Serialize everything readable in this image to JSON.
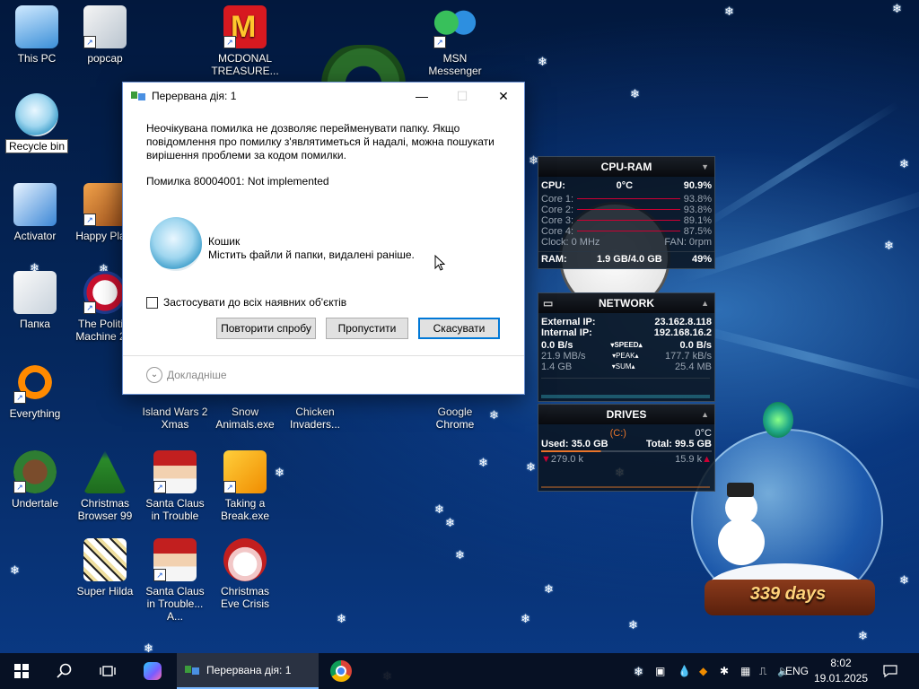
{
  "desktop": {
    "icons": [
      {
        "label": "This PC"
      },
      {
        "label": "popcap"
      },
      {
        "label": "MCDONAL TREASURE..."
      },
      {
        "label": "MSN Messenger"
      },
      {
        "label": "Recycle bin"
      },
      {
        "label": "Activator"
      },
      {
        "label": "Happy Pla..."
      },
      {
        "label": "Папка"
      },
      {
        "label": "The Politi... Machine 2..."
      },
      {
        "label": "Everything"
      },
      {
        "label": "Island Wars 2 Xmas"
      },
      {
        "label": "Snow Animals.exe"
      },
      {
        "label": "Chicken Invaders..."
      },
      {
        "label": "Google Chrome"
      },
      {
        "label": "Undertale"
      },
      {
        "label": "Christmas Browser 99"
      },
      {
        "label": "Santa Claus in Trouble"
      },
      {
        "label": "Taking a Break.exe"
      },
      {
        "label": "Super Hilda"
      },
      {
        "label": "Santa Claus in Trouble... A..."
      },
      {
        "label": "Christmas Eve Crisis"
      }
    ],
    "snowglobe_days": "339 days"
  },
  "dialog": {
    "title": "Перервана дія: 1",
    "message": "Неочікувана помилка не дозволяє перейменувати папку. Якщо повідомлення про помилку з'являтиметься й надалі, можна пошукати вирішення проблеми за кодом помилки.",
    "error_code": "Помилка 80004001: Not implemented",
    "item_name": "Кошик",
    "item_desc": "Містить файли й папки, видалені раніше.",
    "apply_all": "Застосувати до всіх наявних об'єктів",
    "retry": "Повторити спробу",
    "skip": "Пропустити",
    "cancel": "Скасувати",
    "more": "Докладніше"
  },
  "cpu_ram": {
    "title": "CPU-RAM",
    "cpu_label": "CPU:",
    "cpu_temp": "0°C",
    "cpu_pct": "90.9%",
    "cores": [
      {
        "label": "Core 1:",
        "value": "93.8%"
      },
      {
        "label": "Core 2:",
        "value": "93.8%"
      },
      {
        "label": "Core 3:",
        "value": "89.1%"
      },
      {
        "label": "Core 4:",
        "value": "87.5%"
      }
    ],
    "clock": "Clock: 0 MHz",
    "fan": "FAN: 0rpm",
    "ram_label": "RAM:",
    "ram_used": "1.9 GB/4.0 GB",
    "ram_pct": "49%"
  },
  "network": {
    "title": "NETWORK",
    "ext_label": "External IP:",
    "ext_ip": "23.162.8.118",
    "int_label": "Internal IP:",
    "int_ip": "192.168.16.2",
    "down": "0.0 B/s",
    "speed": "SPEED",
    "up": "0.0 B/s",
    "peak_down": "21.9 MB/s",
    "peak": "PEAK",
    "peak_up": "177.7 kB/s",
    "sum_down": "1.4 GB",
    "sum": "SUM",
    "sum_up": "25.4 MB"
  },
  "drives": {
    "title": "DRIVES",
    "drive": "(C:)",
    "temp": "0°C",
    "used": "Used: 35.0 GB",
    "total": "Total: 99.5 GB",
    "read": "279.0 k",
    "write": "15.9 k"
  },
  "taskbar": {
    "active_window": "Перервана дія: 1",
    "lang": "ENG",
    "time": "8:02",
    "date": "19.01.2025"
  }
}
